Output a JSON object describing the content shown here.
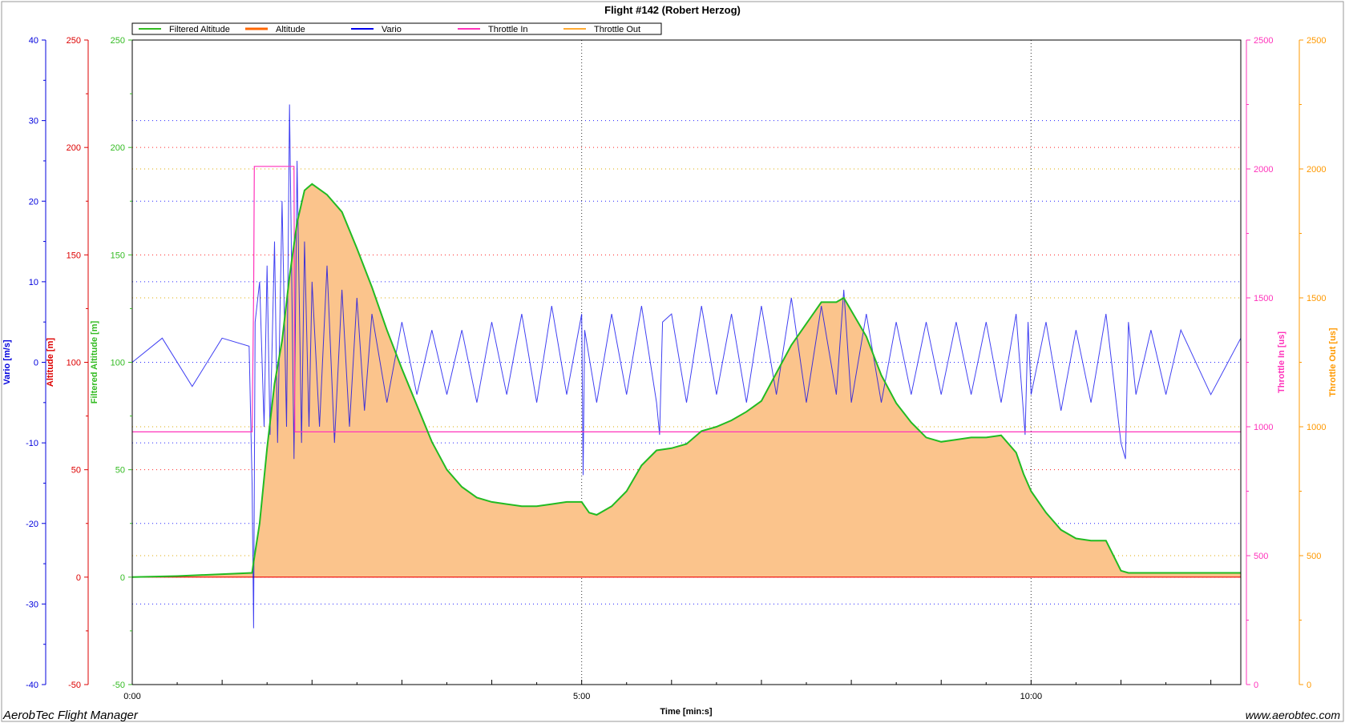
{
  "chart_data": {
    "type": "line",
    "title": "Flight #142 (Robert Herzog)",
    "xlabel": "Time [min:s]",
    "x_range_seconds": [
      0,
      740
    ],
    "x_tick_labels": [
      "0:00",
      "5:00",
      "10:00"
    ],
    "grid": true,
    "legend_placement": "top",
    "legend": [
      {
        "name": "Filtered Altitude",
        "color": "#33bb22"
      },
      {
        "name": "Altitude",
        "color": "#ff6600"
      },
      {
        "name": "Vario",
        "color": "#0000ee"
      },
      {
        "name": "Throttle In",
        "color": "#ff33bb"
      },
      {
        "name": "Throttle Out",
        "color": "#ffaa33"
      }
    ],
    "axes": [
      {
        "key": "vario",
        "label": "Vario [m/s]",
        "color": "#0000dd",
        "side": "left",
        "range": [
          -40,
          40
        ],
        "ticks": [
          "40",
          "30",
          "20",
          "10",
          "0",
          "-10",
          "-20",
          "-30",
          "-40"
        ]
      },
      {
        "key": "altitude",
        "label": "Altitude [m]",
        "color": "#dd0000",
        "side": "left",
        "range": [
          -50,
          250
        ],
        "ticks": [
          "250",
          "200",
          "150",
          "100",
          "50",
          "0",
          "-50"
        ]
      },
      {
        "key": "filtered_altitude",
        "label": "Filtered Altitude [m]",
        "color": "#33bb22",
        "side": "left",
        "range": [
          -50,
          250
        ],
        "ticks": [
          "250",
          "200",
          "150",
          "100",
          "50",
          "0",
          "-50"
        ]
      },
      {
        "key": "throttle_in",
        "label": "Throttle In [us]",
        "color": "#ff33bb",
        "side": "right",
        "range": [
          0,
          2500
        ],
        "ticks": [
          "2500",
          "2000",
          "1500",
          "1000",
          "500",
          "0"
        ]
      },
      {
        "key": "throttle_out",
        "label": "Throttle Out [us]",
        "color": "#ff9900",
        "side": "right",
        "range": [
          0,
          2500
        ],
        "ticks": [
          "2500",
          "2000",
          "1500",
          "1000",
          "500",
          "0"
        ]
      }
    ],
    "series": [
      {
        "name": "Filtered Altitude",
        "axis": "filtered_altitude",
        "x": [
          0,
          30,
          80,
          81,
          85,
          90,
          95,
          100,
          105,
          110,
          115,
          120,
          130,
          140,
          150,
          160,
          170,
          180,
          190,
          200,
          210,
          220,
          230,
          240,
          250,
          260,
          270,
          280,
          290,
          300,
          305,
          310,
          320,
          330,
          340,
          350,
          360,
          370,
          380,
          390,
          400,
          410,
          420,
          430,
          440,
          450,
          460,
          470,
          475,
          480,
          490,
          500,
          510,
          520,
          530,
          540,
          550,
          560,
          570,
          580,
          590,
          595,
          600,
          610,
          620,
          630,
          640,
          650,
          660,
          665,
          670,
          680,
          690,
          700,
          720,
          740
        ],
        "y": [
          0,
          0.5,
          2,
          7,
          25,
          60,
          90,
          110,
          140,
          165,
          180,
          183,
          178,
          170,
          153,
          135,
          115,
          97,
          80,
          63,
          50,
          42,
          37,
          35,
          34,
          33,
          33,
          34,
          35,
          35,
          30,
          29,
          33,
          40,
          52,
          59,
          60,
          62,
          68,
          70,
          73,
          77,
          82,
          95,
          108,
          118,
          128,
          128,
          130,
          124,
          112,
          94,
          81,
          72,
          65,
          63,
          64,
          65,
          65,
          66,
          58,
          48,
          40,
          30,
          22,
          18,
          17,
          17,
          3,
          2,
          2,
          2,
          2,
          2,
          2,
          2
        ]
      },
      {
        "name": "Altitude",
        "axis": "altitude",
        "x": [
          0,
          740
        ],
        "y": [
          0,
          0
        ]
      },
      {
        "name": "Throttle In",
        "axis": "throttle_in",
        "x": [
          0,
          80,
          81,
          81.5,
          108,
          108.5,
          740
        ],
        "y": [
          980,
          980,
          1500,
          2010,
          2010,
          980,
          980
        ]
      },
      {
        "name": "Vario",
        "axis": "vario",
        "x": [
          0,
          20,
          40,
          60,
          78,
          80,
          81,
          82,
          85,
          88,
          90,
          92,
          95,
          97,
          100,
          103,
          105,
          108,
          110,
          113,
          115,
          118,
          120,
          125,
          130,
          135,
          140,
          145,
          150,
          155,
          160,
          170,
          180,
          190,
          200,
          210,
          220,
          230,
          240,
          250,
          260,
          270,
          280,
          290,
          300,
          301,
          302,
          310,
          320,
          330,
          340,
          350,
          352,
          354,
          360,
          370,
          380,
          390,
          400,
          410,
          420,
          430,
          440,
          450,
          460,
          470,
          475,
          480,
          490,
          500,
          510,
          520,
          530,
          540,
          550,
          560,
          570,
          580,
          590,
          596,
          598,
          600,
          610,
          620,
          630,
          640,
          650,
          660,
          663,
          665,
          670,
          680,
          690,
          700,
          720,
          740
        ],
        "y": [
          0,
          3,
          -3,
          3,
          2,
          -15,
          -33,
          5,
          10,
          -8,
          12,
          -9,
          15,
          -10,
          20,
          -8,
          32,
          -12,
          25,
          -10,
          15,
          -8,
          10,
          -8,
          12,
          -10,
          9,
          -8,
          8,
          -6,
          6,
          -5,
          5,
          -4,
          4,
          -4,
          4,
          -5,
          5,
          -4,
          6,
          -5,
          7,
          -4,
          6,
          -14,
          4,
          -5,
          6,
          -4,
          7,
          -5,
          -9,
          5,
          6,
          -5,
          7,
          -4,
          6,
          -5,
          7,
          -4,
          8,
          -5,
          7,
          -4,
          9,
          -5,
          6,
          -5,
          5,
          -4,
          5,
          -4,
          5,
          -4,
          5,
          -5,
          6,
          -9,
          5,
          -4,
          5,
          -6,
          4,
          -5,
          6,
          -10,
          -12,
          5,
          -4,
          4,
          -4,
          4,
          -4,
          3
        ]
      }
    ]
  },
  "footer": {
    "left": "AerobTec Flight Manager",
    "right": "www.aerobtec.com"
  }
}
